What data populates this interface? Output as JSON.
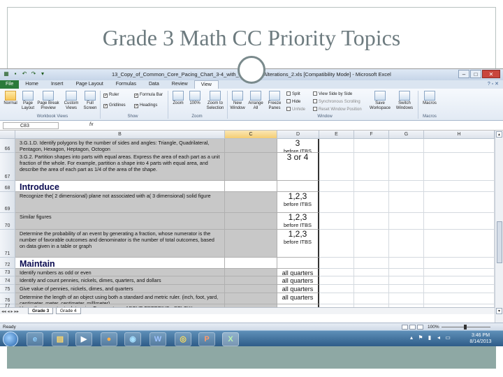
{
  "slide": {
    "title": "Grade 3 Math CC Priority Topics"
  },
  "window": {
    "caption": "13_Copy_of_Common_Core_Pacing_Chart_3-4_with_Diocesan_Alterations_2.xls  [Compatibility Mode] - Microsoft Excel"
  },
  "ribbon": {
    "tabs": [
      "File",
      "Home",
      "Insert",
      "Page Layout",
      "Formulas",
      "Data",
      "Review",
      "View"
    ],
    "active_tab": "View",
    "workbook_views": [
      "Normal",
      "Page Layout",
      "Page Break Preview",
      "Custom Views",
      "Full Screen"
    ],
    "show": {
      "ruler": "Ruler",
      "formula_bar": "Formula Bar",
      "gridlines": "Gridlines",
      "headings": "Headings"
    },
    "zoom": [
      "Zoom",
      "100%",
      "Zoom to Selection"
    ],
    "window": [
      "New Window",
      "Arrange All",
      "Freeze Panes",
      "Split",
      "Hide",
      "Unhide",
      "View Side by Side",
      "Synchronous Scrolling",
      "Reset Window Position",
      "Save Workspace",
      "Switch Windows"
    ],
    "macros": "Macros",
    "groups": [
      "Workbook Views",
      "Show",
      "Zoom",
      "Window",
      "Macros"
    ]
  },
  "formula_bar": {
    "name_box": "C83",
    "fx": "fx"
  },
  "columns": [
    "B",
    "C",
    "D",
    "E",
    "F",
    "G",
    "H"
  ],
  "rows": [
    {
      "num": "66",
      "b": "3.G.1.D. Identify polygons by the number of sides and angles: Triangle, Quadrilateral, Pentagon, Hexagon, Heptagon, Octogon",
      "d_big": "3",
      "d_small": "before ITBS"
    },
    {
      "num": "67",
      "b": "3.G.2. Partition shapes into parts with equal areas. Express the area of each part as a unit fraction of the whole. For example, partition a shape into 4 parts with equal area, and describe the area of each part as 1/4 of the area of the shape.",
      "d_big": "3 or 4",
      "d_small": ""
    },
    {
      "num": "68",
      "b": "Introduce",
      "d_big": "",
      "d_small": ""
    },
    {
      "num": "69",
      "b": "Recognize the( 2 dimensional) plane not associated with a( 3 dimensional) solid figure",
      "d_big": "1,2,3",
      "d_small": "before ITBS"
    },
    {
      "num": "70",
      "b": "Similar figures",
      "d_big": "1,2,3",
      "d_small": "before ITBS"
    },
    {
      "num": "71",
      "b": "Determine the probability of an event by generating a fraction, whose numerator is the number of favorable outcomes and denominator is the number of total outcomes, based on data given in a table or graph",
      "d_big": "1,2,3",
      "d_small": "before ITBS"
    },
    {
      "num": "72",
      "b": "Maintain",
      "d_big": "",
      "d_small": ""
    },
    {
      "num": "73",
      "b": "Identify numbers as odd or even",
      "d_big": "",
      "d_small": "all quarters"
    },
    {
      "num": "74",
      "b": "Identify and count pennies, nickels, dimes, quarters, and dollars",
      "d_big": "",
      "d_small": "all quarters"
    },
    {
      "num": "75",
      "b": "Give value of pennies, nickels, dimes, and quarters",
      "d_big": "",
      "d_small": "all quarters"
    },
    {
      "num": "76",
      "b": "Determine the length of an object using both a standard and metric ruler. (inch, foot, yard, centimeter, meter, centimeter, millimeter)",
      "d_big": "",
      "d_small": "all quarters"
    },
    {
      "num": "77",
      "b": "Use a thermometer to determine Temperature - ABOVE FREEZING - BELOW",
      "d_big": "",
      "d_small": ""
    }
  ],
  "sheet_tabs": [
    "Grade 3",
    "Grade 4"
  ],
  "status": {
    "ready": "Ready",
    "zoom": "100%"
  },
  "taskbar": {
    "time": "3:46 PM",
    "date": "8/14/2013"
  }
}
